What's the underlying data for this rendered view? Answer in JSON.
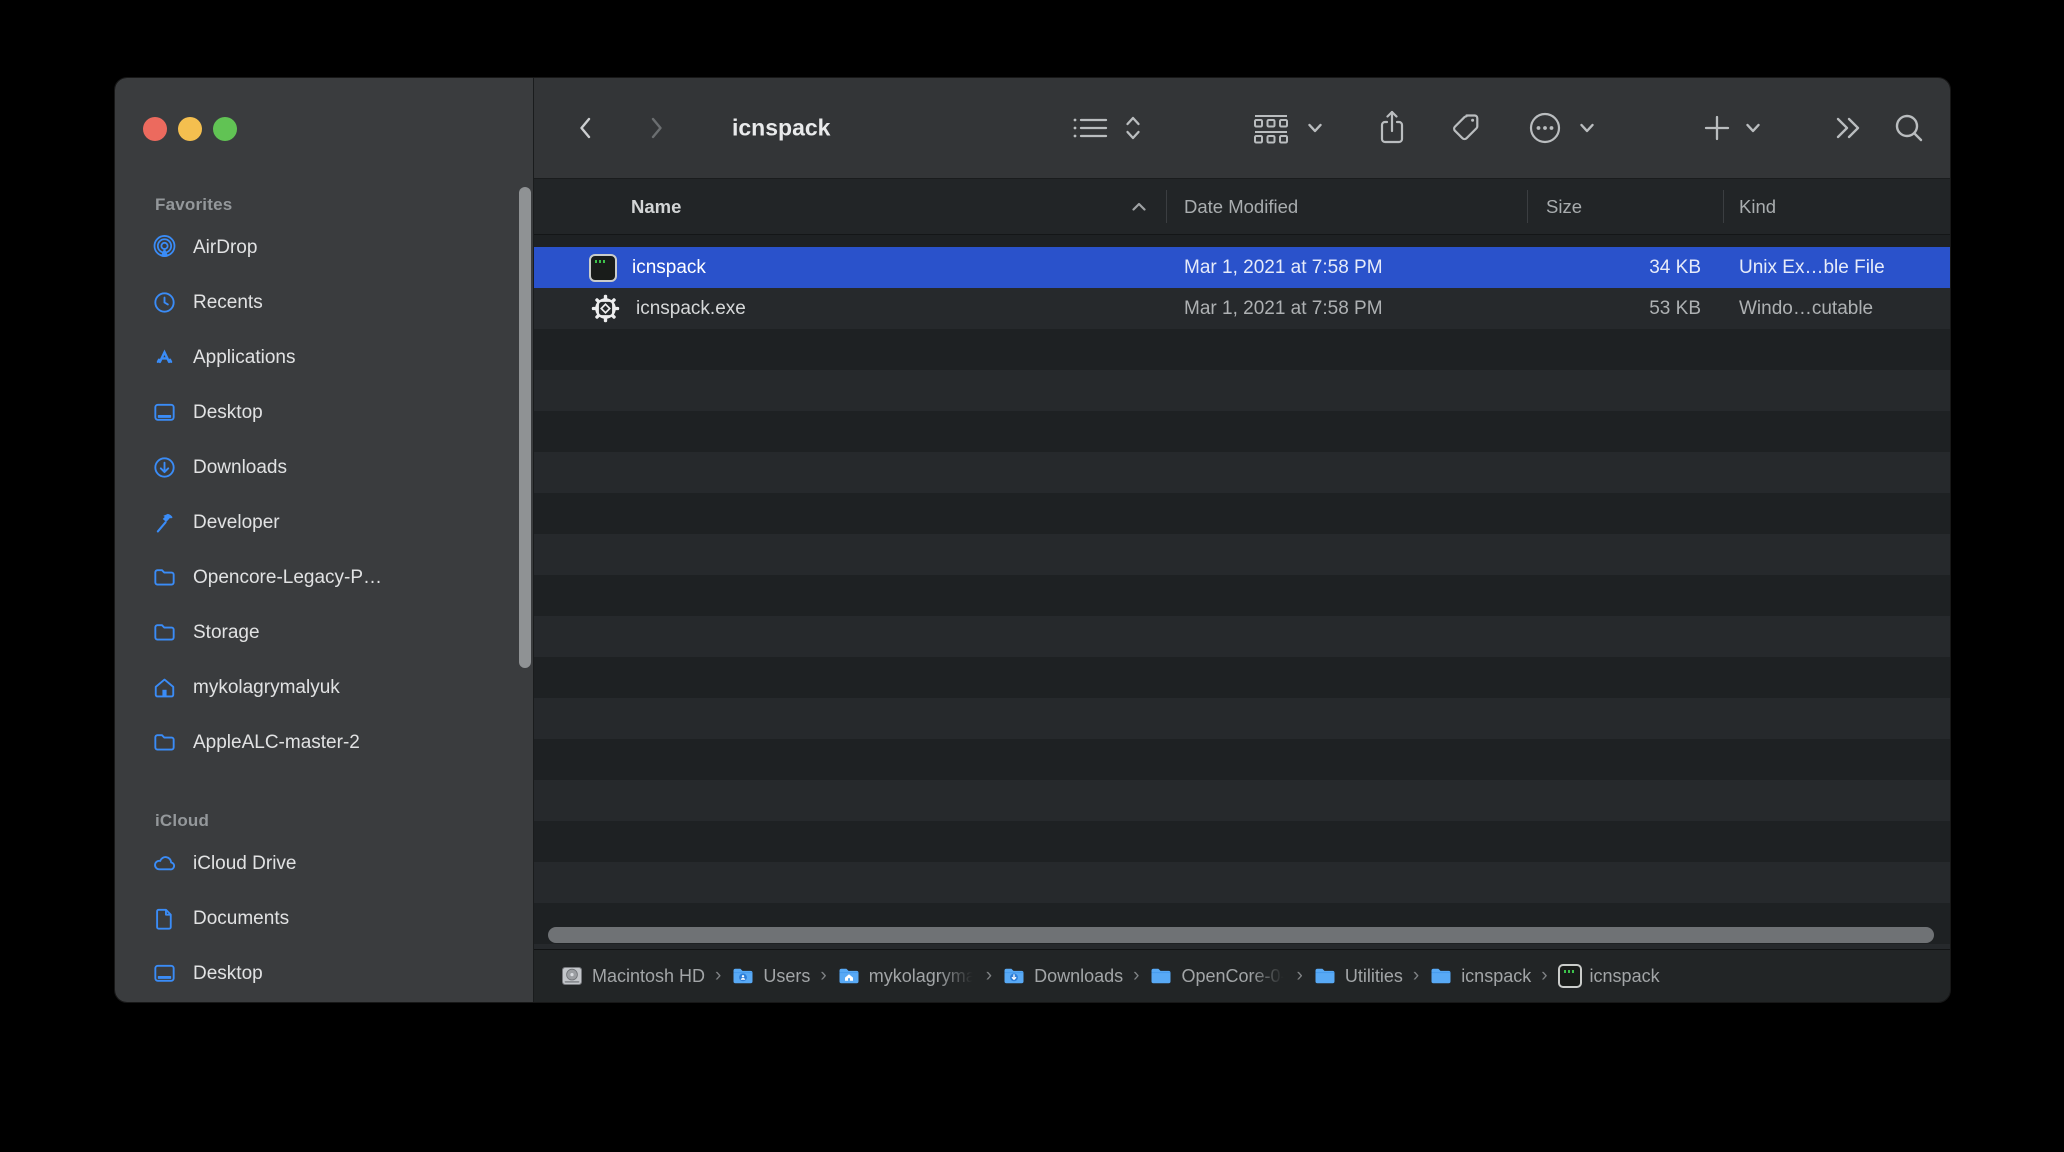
{
  "window": {
    "title": "icnspack"
  },
  "toolbar": {
    "title": "icnspack"
  },
  "sidebar": {
    "sections": [
      {
        "label": "Favorites",
        "items": [
          {
            "label": "AirDrop",
            "icon": "airdrop-icon"
          },
          {
            "label": "Recents",
            "icon": "clock-icon"
          },
          {
            "label": "Applications",
            "icon": "app-store-icon"
          },
          {
            "label": "Desktop",
            "icon": "desktop-icon"
          },
          {
            "label": "Downloads",
            "icon": "download-circle-icon"
          },
          {
            "label": "Developer",
            "icon": "hammer-icon"
          },
          {
            "label": "Opencore-Legacy-P…",
            "icon": "folder-icon"
          },
          {
            "label": "Storage",
            "icon": "folder-icon"
          },
          {
            "label": "mykolagrymalyuk",
            "icon": "home-icon"
          },
          {
            "label": "AppleALC-master-2",
            "icon": "folder-icon"
          }
        ]
      },
      {
        "label": "iCloud",
        "items": [
          {
            "label": "iCloud Drive",
            "icon": "cloud-icon"
          },
          {
            "label": "Documents",
            "icon": "document-icon"
          },
          {
            "label": "Desktop",
            "icon": "desktop-icon"
          }
        ]
      }
    ]
  },
  "list": {
    "columns": {
      "name": "Name",
      "date": "Date Modified",
      "size": "Size",
      "kind": "Kind"
    },
    "sort": {
      "column": "Name",
      "direction": "ascending"
    },
    "rows": [
      {
        "name": "icnspack",
        "date": "Mar 1, 2021 at 7:58 PM",
        "size": "34 KB",
        "kind": "Unix Ex…ble File",
        "icon": "unix-executable-icon",
        "selected": true
      },
      {
        "name": "icnspack.exe",
        "date": "Mar 1, 2021 at 7:58 PM",
        "size": "53 KB",
        "kind": "Windo…cutable",
        "icon": "windows-executable-icon",
        "selected": false
      }
    ]
  },
  "pathbar": {
    "separator": "›",
    "items": [
      {
        "label": "Macintosh HD",
        "icon": "hard-drive-icon"
      },
      {
        "label": "Users",
        "icon": "folder-users-icon"
      },
      {
        "label": "mykolagryma",
        "icon": "folder-home-icon"
      },
      {
        "label": "Downloads",
        "icon": "folder-downloads-icon"
      },
      {
        "label": "OpenCore-0-",
        "icon": "folder-icon"
      },
      {
        "label": "Utilities",
        "icon": "folder-icon"
      },
      {
        "label": "icnspack",
        "icon": "folder-icon"
      },
      {
        "label": "icnspack",
        "icon": "unix-executable-icon"
      }
    ]
  },
  "colors": {
    "selection_blue": "#2a52cb",
    "sidebar_background": "#3a3c3e",
    "toolbar_background": "#333537",
    "list_row_dark": "#1e2123",
    "list_row_light": "#26292c",
    "sidebar_icon_blue": "#3a8cf7",
    "traffic_red": "#ec6a5e",
    "traffic_yellow": "#f4bf4f",
    "traffic_green": "#61c354"
  }
}
